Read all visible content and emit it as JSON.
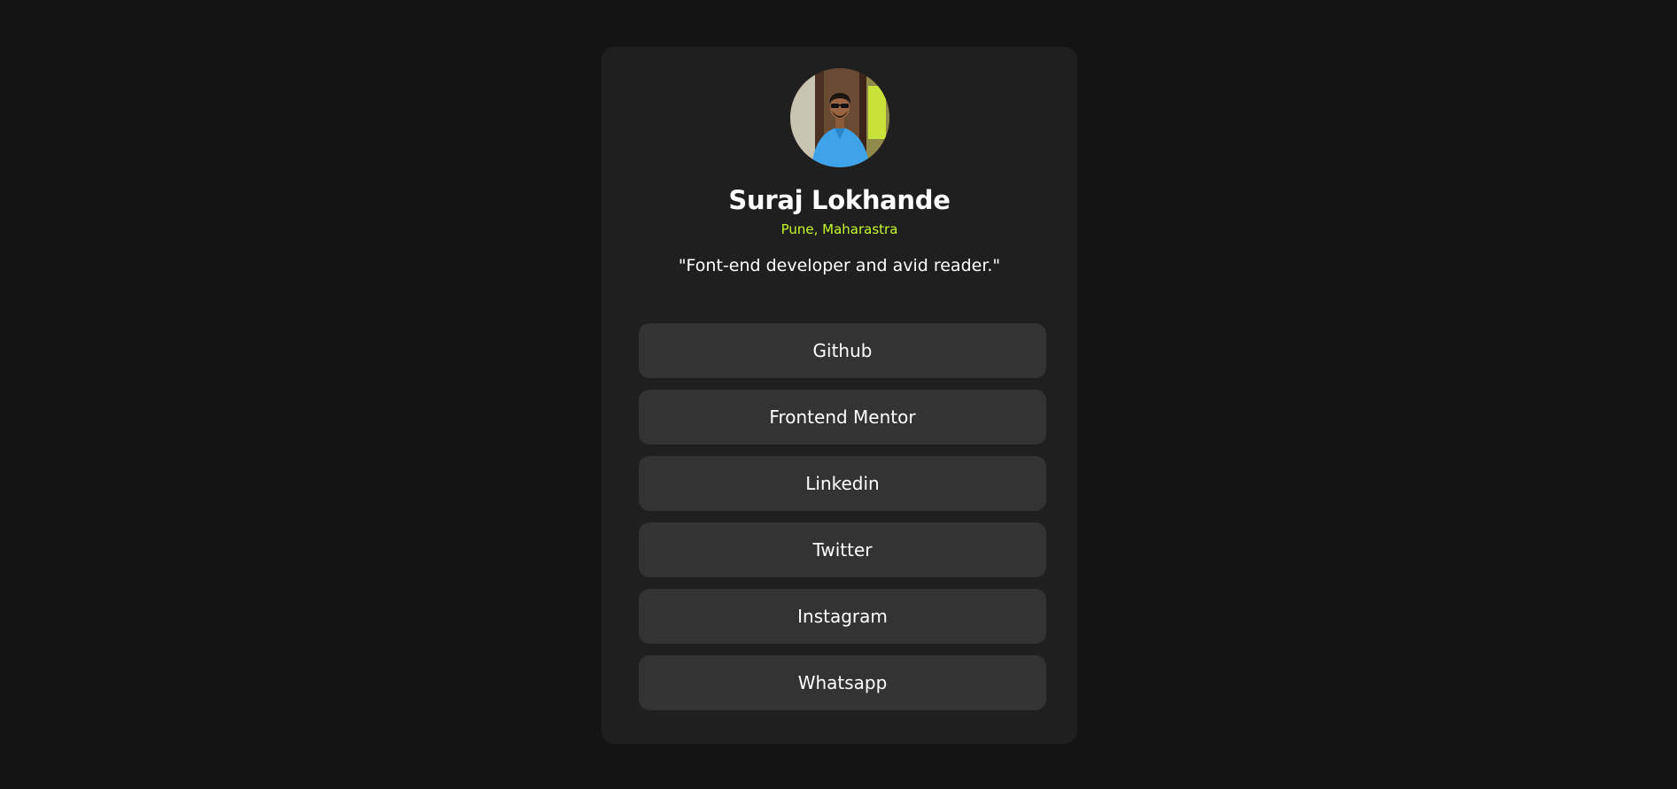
{
  "profile": {
    "name": "Suraj Lokhande",
    "location": "Pune, Maharastra",
    "bio": "\"Font-end developer and avid reader.\"",
    "accent_color": "#c4f82a"
  },
  "links": [
    {
      "label": "Github"
    },
    {
      "label": "Frontend Mentor"
    },
    {
      "label": "Linkedin"
    },
    {
      "label": "Twitter"
    },
    {
      "label": "Instagram"
    },
    {
      "label": "Whatsapp"
    }
  ]
}
